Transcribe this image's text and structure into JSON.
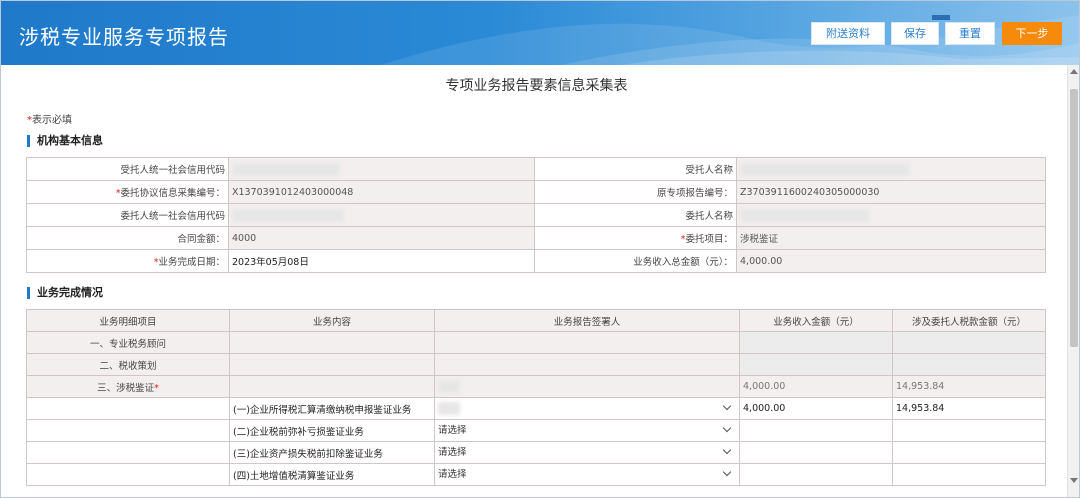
{
  "header": {
    "title": "涉税专业服务专项报告",
    "buttons": {
      "attach": "附送资料",
      "save": "保存",
      "reset": "重置",
      "next": "下一步"
    },
    "colors": {
      "bar": "#1f79c9",
      "next": "#f58a0b"
    }
  },
  "form": {
    "title": "专项业务报告要素信息采集表",
    "required_note": "表示必填"
  },
  "basic": {
    "section_title": "机构基本信息",
    "rows": [
      {
        "l_label": "受托人统一社会信用代码",
        "l_req": false,
        "l_value": "",
        "r_label": "受托人名称",
        "r_req": false,
        "r_value": ""
      },
      {
        "l_label": "委托协议信息采集编号：",
        "l_req": true,
        "l_value": "X1370391012403000048",
        "r_label": "原专项报告编号：",
        "r_req": false,
        "r_value": "Z3703911600240305000030"
      },
      {
        "l_label": "委托人统一社会信用代码",
        "l_req": false,
        "l_value": "",
        "r_label": "委托人名称",
        "r_req": false,
        "r_value": ""
      },
      {
        "l_label": "合同金额：",
        "l_req": false,
        "l_value": "4000",
        "r_label": "委托项目：",
        "r_req": true,
        "r_value": "涉税鉴证"
      },
      {
        "l_label": "业务完成日期：",
        "l_req": true,
        "l_value": "2023年05月08日",
        "r_label": "业务收入总金额（元）：",
        "r_req": false,
        "r_value": "4,000.00"
      }
    ]
  },
  "business": {
    "section_title": "业务完成情况",
    "columns": [
      "业务明细项目",
      "业务内容",
      "业务报告签署人",
      "业务收入金额（元）",
      "涉及委托人税款金额（元）"
    ],
    "categories": [
      {
        "label": "一、专业税务顾问",
        "req": false
      },
      {
        "label": "二、税收策划",
        "req": false
      },
      {
        "label": "三、涉税鉴证",
        "req": true,
        "income": "4,000.00",
        "tax": "14,953.84"
      }
    ],
    "items": [
      {
        "label": "(一)企业所得税汇算清缴纳税申报鉴证业务",
        "signer": "",
        "income": "4,000.00",
        "tax": "14,953.84"
      },
      {
        "label": "(二)企业税前弥补亏损鉴证业务",
        "signer": "请选择",
        "income": "",
        "tax": ""
      },
      {
        "label": "(三)企业资产损失税前扣除鉴证业务",
        "signer": "请选择",
        "income": "",
        "tax": ""
      },
      {
        "label": "(四)土地增值税清算鉴证业务",
        "signer": "请选择",
        "income": "",
        "tax": ""
      }
    ]
  }
}
